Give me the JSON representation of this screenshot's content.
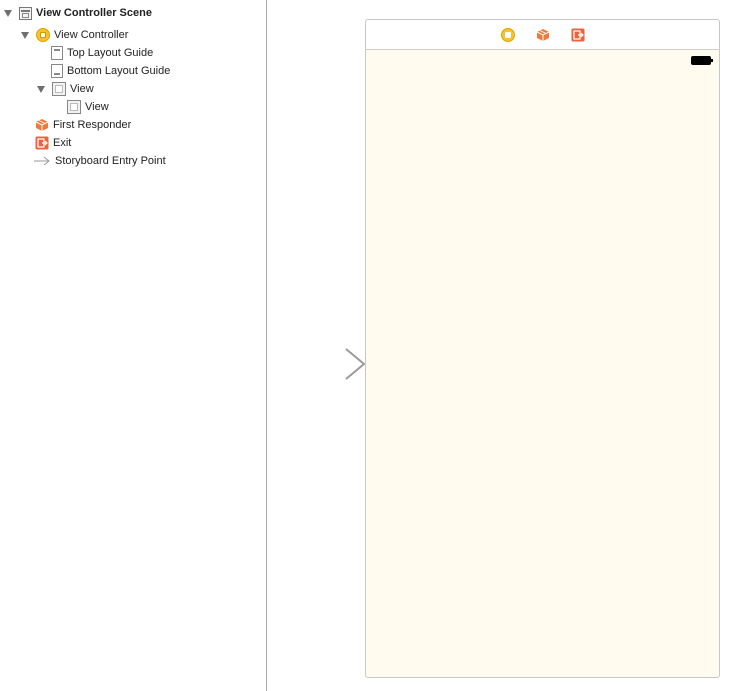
{
  "outline": {
    "items": [
      {
        "label": "View Controller Scene",
        "icon": "scene-icon",
        "expanded": true
      },
      {
        "label": "View Controller",
        "icon": "view-controller-icon",
        "expanded": true
      },
      {
        "label": "Top Layout Guide",
        "icon": "top-layout-guide-icon"
      },
      {
        "label": "Bottom Layout Guide",
        "icon": "bottom-layout-guide-icon"
      },
      {
        "label": "View",
        "icon": "view-icon",
        "expanded": true
      },
      {
        "label": "View",
        "icon": "view-icon"
      },
      {
        "label": "First Responder",
        "icon": "first-responder-icon"
      },
      {
        "label": "Exit",
        "icon": "exit-icon"
      },
      {
        "label": "Storyboard Entry Point",
        "icon": "entry-point-arrow-icon"
      }
    ]
  },
  "canvas": {
    "background_color": "#fffbef",
    "dock_icons": [
      "view-controller-icon",
      "first-responder-icon",
      "exit-icon"
    ],
    "status_bar": {
      "icon": "battery-icon"
    }
  },
  "colors": {
    "view_controller": "#f7c22f",
    "first_responder": "#f07a3a",
    "exit": "#e8643c",
    "divider": "#a9a9a9"
  }
}
